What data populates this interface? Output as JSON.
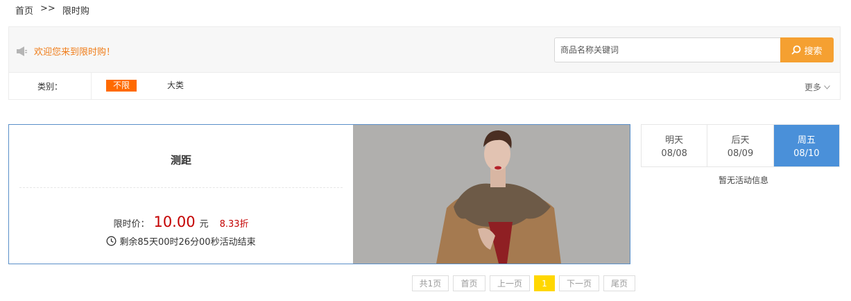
{
  "breadcrumb": {
    "home": "首页",
    "separator": ">>",
    "current": "限时购"
  },
  "welcome_text": "欢迎您来到限时购！",
  "search": {
    "placeholder": "商品名称关键词",
    "button_label": "搜索"
  },
  "category": {
    "label": "类别：",
    "options": [
      "不限",
      "大类"
    ],
    "more_label": "更多"
  },
  "product": {
    "name": "测距",
    "price_label": "限时价：",
    "price": "10.00",
    "price_unit": "元",
    "discount": "8.33折",
    "countdown": "剩余85天00时26分00秒活动结束"
  },
  "day_tabs": [
    {
      "name": "明天",
      "date": "08/08"
    },
    {
      "name": "后天",
      "date": "08/09"
    },
    {
      "name": "周五",
      "date": "08/10"
    }
  ],
  "no_activity": "暂无活动信息",
  "pager": {
    "total": "共1页",
    "first": "首页",
    "prev": "上一页",
    "current": "1",
    "next": "下一页",
    "last": "尾页"
  },
  "colors": {
    "accent": "#f5a031",
    "welcome": "#f07d1a",
    "tag": "#ff6a00",
    "price": "#c40000",
    "active_tab": "#4a90d9",
    "page_current": "#ffd700"
  }
}
